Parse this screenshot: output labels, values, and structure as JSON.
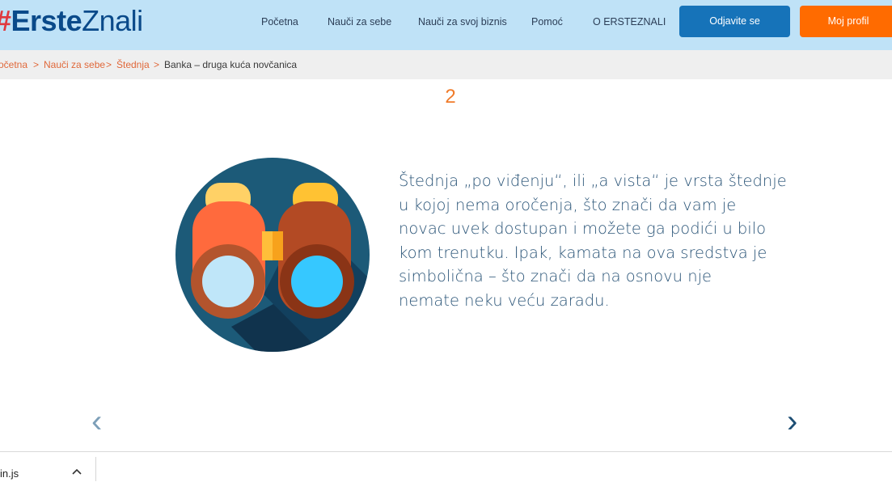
{
  "header": {
    "logo": {
      "hash": "#",
      "erste": "Erste",
      "znali": "Znali"
    },
    "nav": [
      "Početna",
      "Nauči za sebe",
      "Nauči za svoj biznis",
      "Pomoć",
      "O ERSTEZNALI"
    ],
    "logout_label": "Odjavite se",
    "profile_label": "Moj profil"
  },
  "breadcrumb": {
    "items": [
      "očetna",
      "Nauči za sebe",
      "Štednja"
    ],
    "separator": ">",
    "current": "Banka – druga kuća novčanica"
  },
  "slide": {
    "number": "2",
    "text_lines": [
      "Štednja „po viđenju“, ili „a vista“ je vrsta štednje",
      "u kojoj nema oročenja, što znači da vam je",
      "novac uvek dostupan i možete ga podići u bilo",
      "kom trenutku. Ipak, kamata na ova sredstva je",
      "simbolična – što znači da na osnovu nje",
      "nemate neku veću zaradu."
    ],
    "prev_arrow": "‹",
    "next_arrow": "›"
  },
  "download_bar": {
    "filename": "in.js"
  },
  "colors": {
    "accent_orange": "#ff6b00",
    "primary_blue": "#1673b9",
    "header_bg": "#bfe2f7"
  }
}
